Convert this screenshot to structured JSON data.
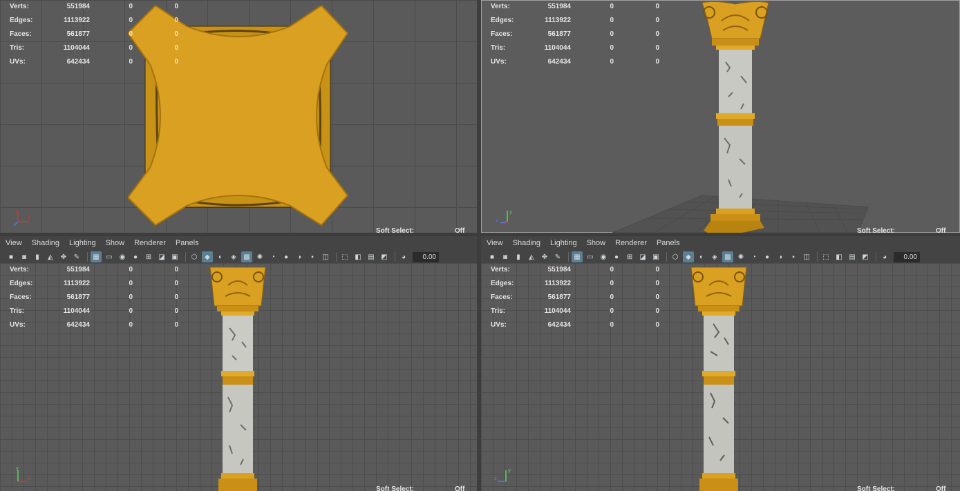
{
  "hud": {
    "rows": [
      {
        "label": "Verts:",
        "value": "551984",
        "sel": "0",
        "comp": "0"
      },
      {
        "label": "Edges:",
        "value": "1113922",
        "sel": "0",
        "comp": "0"
      },
      {
        "label": "Faces:",
        "value": "561877",
        "sel": "0",
        "comp": "0"
      },
      {
        "label": "Tris:",
        "value": "1104044",
        "sel": "0",
        "comp": "0"
      },
      {
        "label": "UVs:",
        "value": "642434",
        "sel": "0",
        "comp": "0"
      }
    ]
  },
  "soft_select": {
    "label": "Soft Select:",
    "value": "Off"
  },
  "panel_menu": [
    "View",
    "Shading",
    "Lighting",
    "Show",
    "Renderer",
    "Panels"
  ],
  "toolbar": {
    "field_value": "0.00",
    "icons": [
      "camera-icon",
      "camera-attributes-icon",
      "bookmark-icon",
      "image-plane-icon",
      "2d-pan-zoom-icon",
      "grease-pencil-icon",
      "grid-icon",
      "film-gate-icon",
      "resolution-gate-icon",
      "gate-mask-icon",
      "field-chart-icon",
      "safe-action-icon",
      "safe-title-icon",
      "wireframe-icon",
      "smooth-shade-icon",
      "default-material-icon",
      "wireframe-on-shaded-icon",
      "textured-icon",
      "use-all-lights-icon",
      "shadows-icon",
      "screen-space-ao-icon",
      "motion-blur-icon",
      "multisample-aa-icon",
      "depth-of-field-icon",
      "isolate-select-icon",
      "xray-icon",
      "xray-joints-icon",
      "xray-active-icon",
      "exposure-icon"
    ]
  },
  "colors": {
    "gold": "#d9a021",
    "gold_dark": "#9a6a0c",
    "marble": "#c9c9c4",
    "marble_dark": "#7a7a76",
    "axis_x": "#d23a3a",
    "axis_y": "#5cd65c",
    "axis_z": "#4a7cff"
  },
  "axis_labels": {
    "x": "x",
    "y": "y",
    "z": "z"
  }
}
